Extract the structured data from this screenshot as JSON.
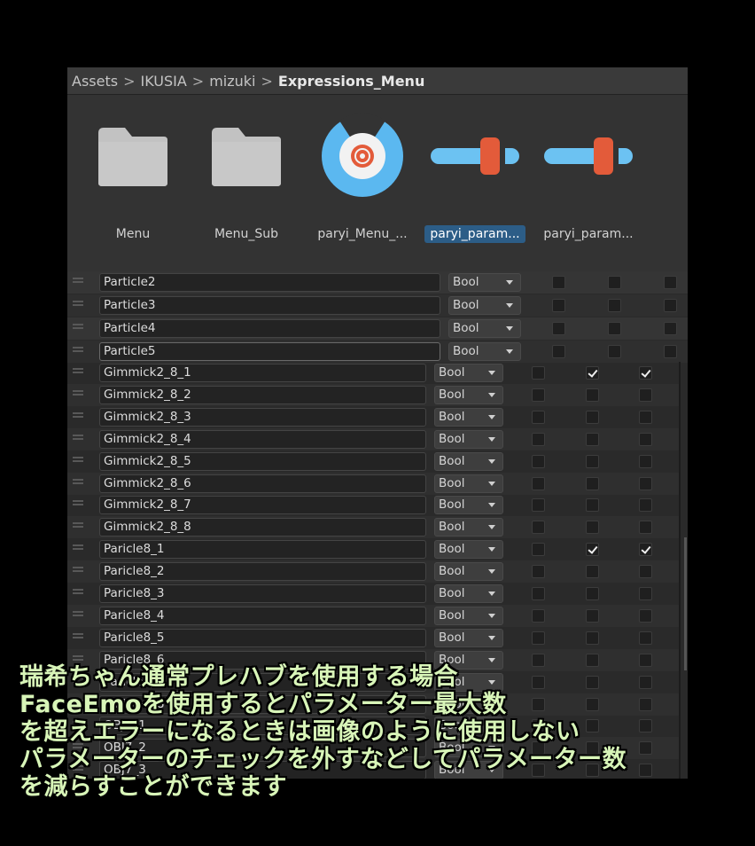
{
  "breadcrumb": [
    "Assets",
    "IKUSIA",
    "mizuki",
    "Expressions_Menu"
  ],
  "breadcrumb_sep": ">",
  "assets": [
    {
      "label": "Menu",
      "icon": "folder-icon",
      "selected": false
    },
    {
      "label": "Menu_Sub",
      "icon": "folder-icon",
      "selected": false
    },
    {
      "label": "paryi_Menu_...",
      "icon": "expressions-menu-icon",
      "selected": false
    },
    {
      "label": "paryi_param...",
      "icon": "parameters-icon",
      "selected": true
    },
    {
      "label": "paryi_param...",
      "icon": "parameters-icon",
      "selected": false
    }
  ],
  "colors": {
    "folder": "#c2c2c2",
    "menu_icon": "#5bb8f0",
    "param_bar": "#6cc2f2",
    "param_knob": "#e35b3a",
    "selected": "#2c5d87",
    "caption": "#d8f5b8"
  },
  "params_top": [
    {
      "name": "Particle2",
      "type": "Bool",
      "checks": [
        false,
        false,
        false
      ]
    },
    {
      "name": "Particle3",
      "type": "Bool",
      "checks": [
        false,
        false,
        false
      ]
    },
    {
      "name": "Particle4",
      "type": "Bool",
      "checks": [
        false,
        false,
        false
      ]
    },
    {
      "name": "Particle5",
      "type": "Bool",
      "checks": [
        false,
        false,
        false
      ]
    }
  ],
  "params": [
    {
      "name": "Gimmick2_8_1",
      "type": "Bool",
      "checks": [
        false,
        true,
        true
      ]
    },
    {
      "name": "Gimmick2_8_2",
      "type": "Bool",
      "checks": [
        false,
        false,
        false
      ]
    },
    {
      "name": "Gimmick2_8_3",
      "type": "Bool",
      "checks": [
        false,
        false,
        false
      ]
    },
    {
      "name": "Gimmick2_8_4",
      "type": "Bool",
      "checks": [
        false,
        false,
        false
      ]
    },
    {
      "name": "Gimmick2_8_5",
      "type": "Bool",
      "checks": [
        false,
        false,
        false
      ]
    },
    {
      "name": "Gimmick2_8_6",
      "type": "Bool",
      "checks": [
        false,
        false,
        false
      ]
    },
    {
      "name": "Gimmick2_8_7",
      "type": "Bool",
      "checks": [
        false,
        false,
        false
      ]
    },
    {
      "name": "Gimmick2_8_8",
      "type": "Bool",
      "checks": [
        false,
        false,
        false
      ]
    },
    {
      "name": "Paricle8_1",
      "type": "Bool",
      "checks": [
        false,
        true,
        true
      ]
    },
    {
      "name": "Paricle8_2",
      "type": "Bool",
      "checks": [
        false,
        false,
        false
      ]
    },
    {
      "name": "Paricle8_3",
      "type": "Bool",
      "checks": [
        false,
        false,
        false
      ]
    },
    {
      "name": "Paricle8_4",
      "type": "Bool",
      "checks": [
        false,
        false,
        false
      ]
    },
    {
      "name": "Paricle8_5",
      "type": "Bool",
      "checks": [
        false,
        false,
        false
      ]
    },
    {
      "name": "Paricle8_6",
      "type": "Bool",
      "checks": [
        false,
        false,
        false
      ]
    },
    {
      "name": "Paricle8_7",
      "type": "Bool",
      "checks": [
        false,
        false,
        false
      ]
    },
    {
      "name": "Paricle8_8",
      "type": "Bool",
      "checks": [
        false,
        false,
        false
      ]
    },
    {
      "name": "OBJ7_1",
      "type": "Bool",
      "checks": [
        false,
        false,
        false
      ]
    },
    {
      "name": "OBJ7_2",
      "type": "Bool",
      "checks": [
        false,
        false,
        false
      ]
    },
    {
      "name": "OBJ7_3",
      "type": "Bool",
      "checks": [
        false,
        false,
        false
      ]
    }
  ],
  "caption": [
    "瑞希ちゃん通常プレハブを使用する場合",
    "FaceEmoを使用するとパラメーター最大数",
    "を超えエラーになるときは画像のように使用しない",
    "パラメーターのチェックを外すなどしてパラメーター数",
    "を減らすことができます"
  ]
}
